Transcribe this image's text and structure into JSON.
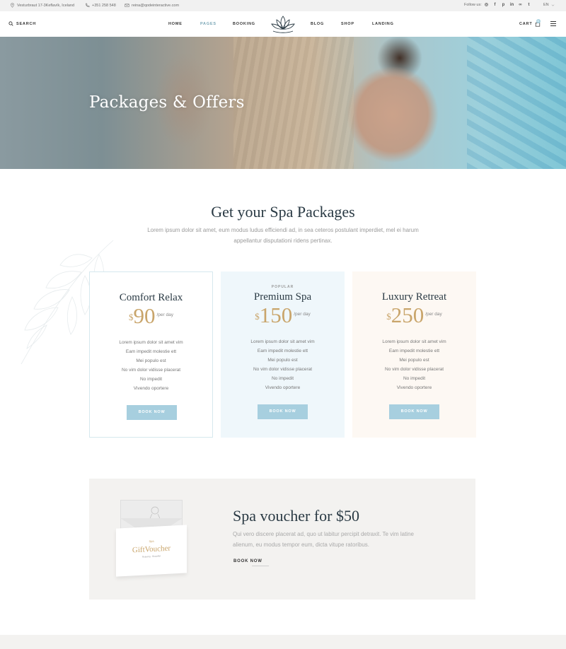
{
  "topbar": {
    "address": "Vesturbraut 17-3Keflavík, Iceland",
    "phone": "+351 258 548",
    "email": "reina@qodeinteractive.com",
    "follow_label": "Follow us:",
    "social_icons": [
      "instagram-icon",
      "facebook-icon",
      "pinterest-icon",
      "linkedin-icon",
      "tripadvisor-icon",
      "twitter-icon"
    ],
    "language": "EN"
  },
  "header": {
    "search_label": "SEARCH",
    "nav": [
      "HOME",
      "PAGES",
      "BOOKING",
      "BLOG",
      "SHOP",
      "LANDING"
    ],
    "active_nav": "PAGES",
    "cart_label": "CART",
    "cart_count": "0"
  },
  "hero": {
    "title": "Packages & Offers"
  },
  "packages_section": {
    "title": "Get your Spa Packages",
    "description": "Lorem ipsum dolor sit amet, eum modus ludus efficiendi ad, in sea ceteros postulant imperdiet, mel ei harum appellantur disputationi ridens pertinax."
  },
  "packages": [
    {
      "badge": "",
      "name": "Comfort Relax",
      "currency": "$",
      "price": "90",
      "period": "/per day",
      "features": [
        "Lorem ipsum dolor sit amet vim",
        "Eam impedit molestie ett",
        "Mei populo est",
        "No vim dolor vidisse placerat",
        "No impedit",
        "Vivendo oportere"
      ],
      "button": "BOOK NOW"
    },
    {
      "badge": "POPULAR",
      "name": "Premium Spa",
      "currency": "$",
      "price": "150",
      "period": "/per day",
      "features": [
        "Lorem ipsum dolor sit amet vim",
        "Eam impedit molestie ett",
        "Mei populo est",
        "No vim dolor vidisse placerat",
        "No impedit",
        "Vivendo oportere"
      ],
      "button": "BOOK NOW"
    },
    {
      "badge": "",
      "name": "Luxury Retreat",
      "currency": "$",
      "price": "250",
      "period": "/per day",
      "features": [
        "Lorem ipsum dolor sit amet vim",
        "Eam impedit molestie ett",
        "Mei populo est",
        "No vim dolor vidisse placerat",
        "No impedit",
        "Vivendo oportere"
      ],
      "button": "BOOK NOW"
    }
  ],
  "voucher": {
    "card_small": "Spa",
    "card_title": "GiftVoucher",
    "card_sub": "Relaxing · Beautiful",
    "title": "Spa voucher for $50",
    "description": "Qui vero discere placerat ad, quo ut labitur percipit detraxit. Te vim latine alienum, eu modus tempor eum, dicta vitupe ratoribus.",
    "button": "BOOK NOW"
  },
  "colors": {
    "accent_gold": "#c9a56b",
    "button_blue": "#a7cfdf",
    "heading": "#2a3a44"
  }
}
